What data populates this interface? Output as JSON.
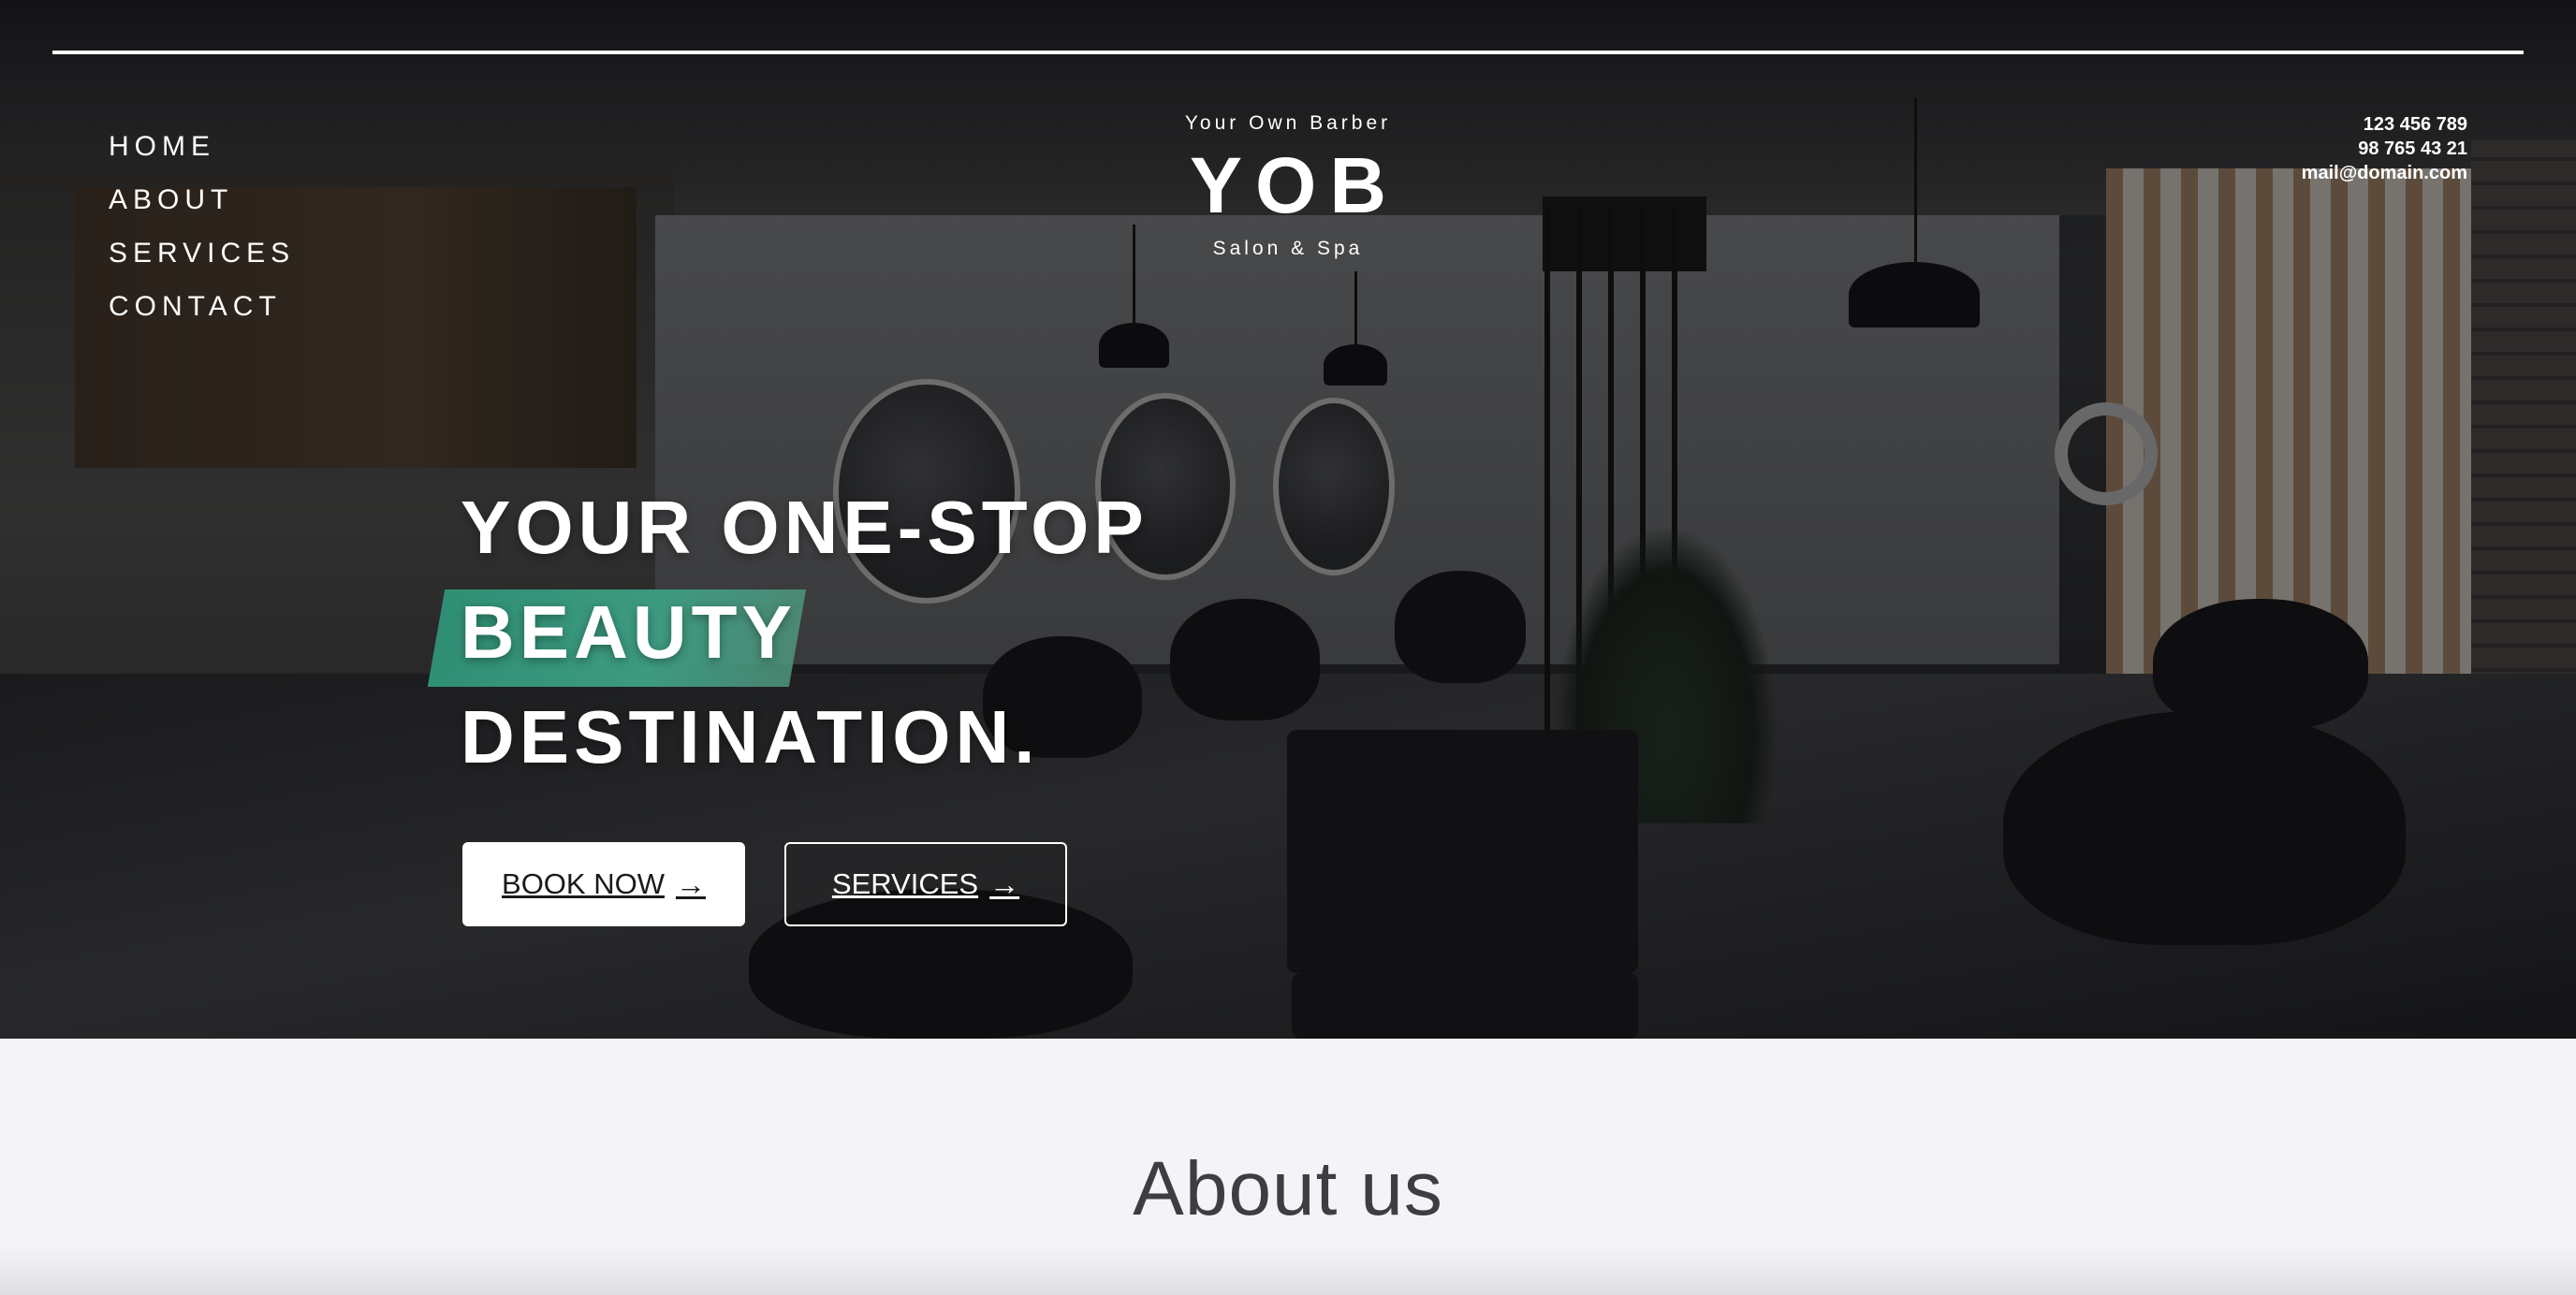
{
  "nav": {
    "items": [
      {
        "label": "HOME"
      },
      {
        "label": "ABOUT"
      },
      {
        "label": "SERVICES"
      },
      {
        "label": "CONTACT"
      }
    ]
  },
  "brand": {
    "tagline": "Your Own Barber",
    "logo": "YOB",
    "subtitle": "Salon & Spa"
  },
  "contact": {
    "phone_1": "123 456 789",
    "phone_2": "98 765 43 21",
    "email": "mail@domain.com"
  },
  "hero": {
    "line_1": "YOUR ONE-STOP",
    "line_2": "BEAUTY",
    "line_3": "DESTINATION.",
    "highlight_color": "#3a9a7e",
    "book_button": "BOOK NOW",
    "services_button": "SERVICES",
    "arrow_icon": "→"
  },
  "about": {
    "title": "About us"
  }
}
